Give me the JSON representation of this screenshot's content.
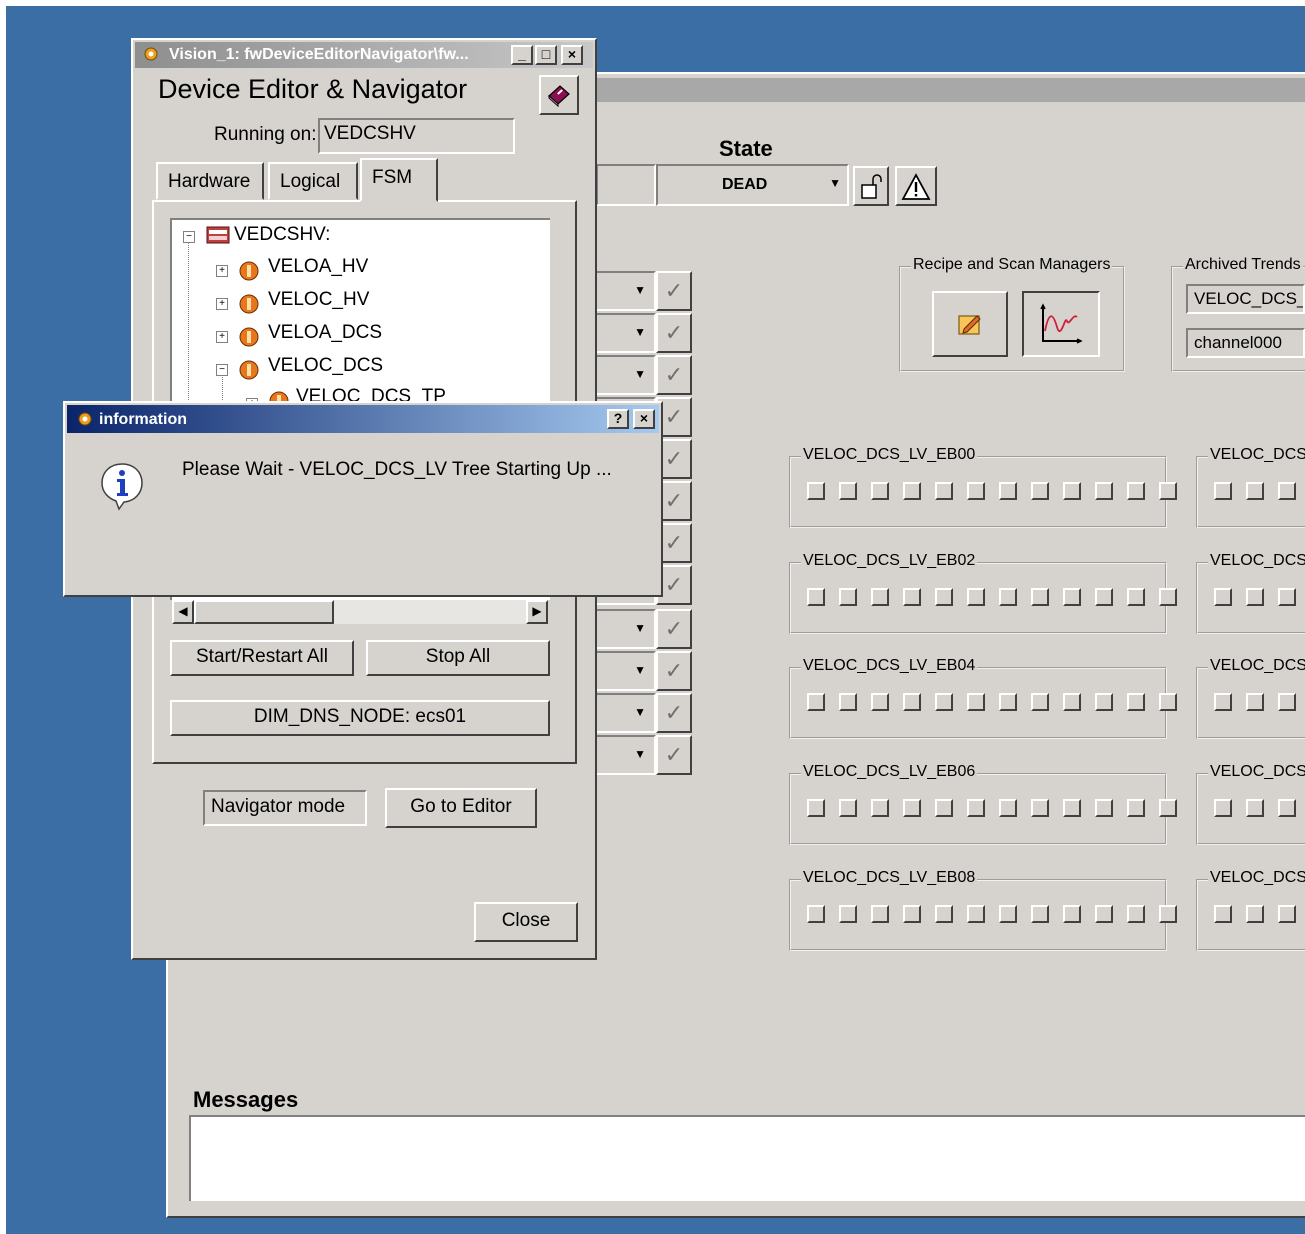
{
  "main": {
    "state_label": "State",
    "state_value": "DEAD",
    "row_count": 12,
    "recipe_group_title": "Recipe and Scan Managers",
    "archived": {
      "title": "Archived Trends",
      "field1": "VELOC_DCS_L",
      "field2": "channel000"
    },
    "lv_groups_left": [
      "VELOC_DCS_LV_EB00",
      "VELOC_DCS_LV_EB02",
      "VELOC_DCS_LV_EB04",
      "VELOC_DCS_LV_EB06",
      "VELOC_DCS_LV_EB08"
    ],
    "lv_groups_right": [
      "VELOC_DCS",
      "VELOC_DCS",
      "VELOC_DCS",
      "VELOC_DCS",
      "VELOC_DCS"
    ],
    "messages_label": "Messages"
  },
  "navigator": {
    "window_title": "Vision_1: fwDeviceEditorNavigator\\fw...",
    "heading": "Device Editor & Navigator",
    "running_on_label": "Running on:",
    "running_on_value": "VEDCSHV",
    "tabs": [
      "Hardware",
      "Logical",
      "FSM"
    ],
    "active_tab": "FSM",
    "tree": {
      "root": "VEDCSHV:",
      "children": [
        "VELOA_HV",
        "VELOC_HV",
        "VELOA_DCS",
        "VELOC_DCS"
      ],
      "partial": "VELOC_DCS_TP"
    },
    "start_restart_label": "Start/Restart All",
    "stop_all_label": "Stop All",
    "dns_node_label": "DIM_DNS_NODE: ecs01",
    "mode_value": "Navigator mode",
    "go_to_editor_label": "Go to Editor",
    "close_label": "Close"
  },
  "info_dialog": {
    "title": "information",
    "help_btn": "?",
    "close_btn": "×",
    "message": "Please Wait - VELOC_DCS_LV Tree Starting Up ..."
  },
  "colors": {
    "desktop": "#3a6ea5",
    "face": "#d6d3ce",
    "dialog_title": "#0a246a"
  }
}
